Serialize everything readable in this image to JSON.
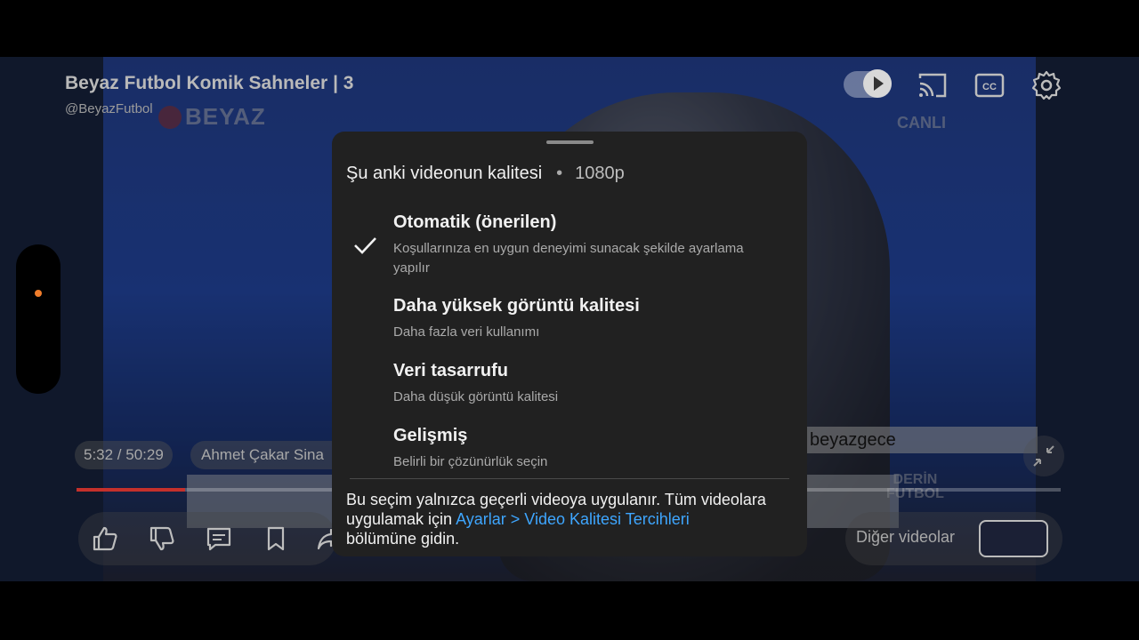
{
  "video": {
    "title": "Beyaz Futbol Komik Sahneler | 3",
    "channel": "@BeyazFutbol",
    "overlay_logo": "BEYAZ",
    "live_tag": "CANLI",
    "ticker": "beyazgece",
    "show_logo_line1": "DERİN",
    "show_logo_line2": "FUTBOL"
  },
  "top_icons": [
    "autoplay-toggle-icon",
    "cast-icon",
    "captions-icon",
    "settings-gear-icon"
  ],
  "player": {
    "time": "5:32 / 50:29",
    "chapter": "Ahmet Çakar Sina",
    "progress_fraction": 0.11,
    "more_videos_label": "Diğer videolar",
    "progress_color": "#c4302b"
  },
  "actions": [
    "like-icon",
    "dislike-icon",
    "comment-icon",
    "save-icon",
    "share-icon"
  ],
  "quality_sheet": {
    "header_label": "Şu anki videonun kalitesi",
    "separator": "•",
    "current_quality": "1080p",
    "options": [
      {
        "title": "Otomatik (önerilen)",
        "subtitle": "Koşullarınıza en uygun deneyimi sunacak şekilde ayarlama yapılır",
        "selected": true
      },
      {
        "title": "Daha yüksek görüntü kalitesi",
        "subtitle": "Daha fazla veri kullanımı",
        "selected": false
      },
      {
        "title": "Veri tasarrufu",
        "subtitle": "Daha düşük görüntü kalitesi",
        "selected": false
      },
      {
        "title": "Gelişmiş",
        "subtitle": "Belirli bir çözünürlük seçin",
        "selected": false
      }
    ],
    "footer_prefix": "Bu seçim yalnızca geçerli videoya uygulanır. Tüm videolara uygulamak için",
    "footer_link": "Ayarlar > Video Kalitesi Tercihleri",
    "footer_suffix": "bölümüne gidin.",
    "link_color": "#3ea6ff"
  }
}
